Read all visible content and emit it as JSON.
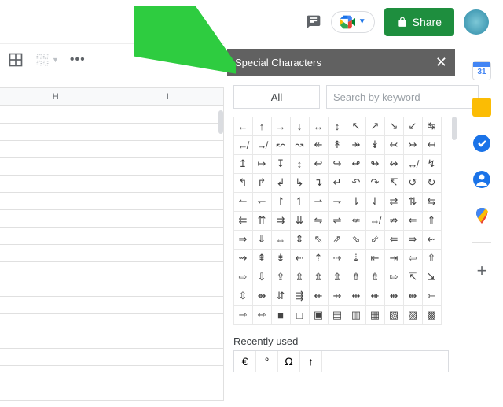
{
  "header": {
    "share_label": "Share"
  },
  "toolbar": {
    "more": "•••"
  },
  "sheet": {
    "columns": [
      "H",
      "I"
    ]
  },
  "panel": {
    "title": "Special Characters",
    "all_label": "All",
    "search_placeholder": "Search by keyword",
    "chars": [
      "←",
      "↑",
      "→",
      "↓",
      "↔",
      "↕",
      "↖",
      "↗",
      "↘",
      "↙",
      "↹",
      "↚",
      "↛",
      "↜",
      "↝",
      "↞",
      "↟",
      "↠",
      "↡",
      "↢",
      "↣",
      "↤",
      "↥",
      "↦",
      "↧",
      "↨",
      "↩",
      "↪",
      "↫",
      "↬",
      "↭",
      "↮",
      "↯",
      "↰",
      "↱",
      "↲",
      "↳",
      "↴",
      "↵",
      "↶",
      "↷",
      "↸",
      "↺",
      "↻",
      "↼",
      "↽",
      "↾",
      "↿",
      "⇀",
      "⇁",
      "⇂",
      "⇃",
      "⇄",
      "⇅",
      "⇆",
      "⇇",
      "⇈",
      "⇉",
      "⇊",
      "⇋",
      "⇌",
      "⇍",
      "⇎",
      "⇏",
      "⇐",
      "⇑",
      "⇒",
      "⇓",
      "⇔",
      "⇕",
      "⇖",
      "⇗",
      "⇘",
      "⇙",
      "⇚",
      "⇛",
      "⇜",
      "⇝",
      "⇞",
      "⇟",
      "⇠",
      "⇡",
      "⇢",
      "⇣",
      "⇤",
      "⇥",
      "⇦",
      "⇧",
      "⇨",
      "⇩",
      "⇪",
      "⇫",
      "⇬",
      "⇭",
      "⇮",
      "⇯",
      "⇰",
      "⇱",
      "⇲",
      "⇳",
      "⇴",
      "⇵",
      "⇶",
      "⇷",
      "⇸",
      "⇹",
      "⇺",
      "⇻",
      "⇼",
      "⇽",
      "⇾",
      "⇿",
      "■",
      "□",
      "▣",
      "▤",
      "▥",
      "▦",
      "▧",
      "▨",
      "▩"
    ],
    "recent_label": "Recently used",
    "recent": [
      "€",
      "°",
      "Ω",
      "↑"
    ]
  }
}
